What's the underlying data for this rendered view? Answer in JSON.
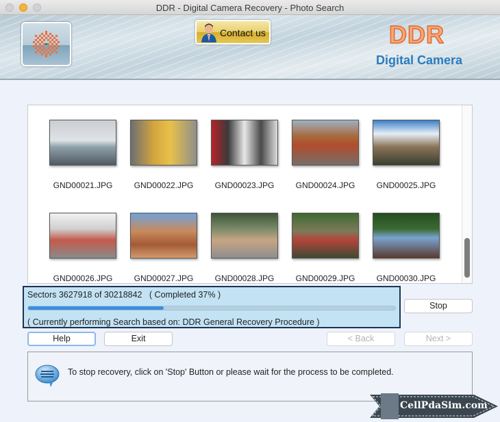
{
  "window": {
    "title": "DDR - Digital Camera Recovery - Photo Search"
  },
  "header": {
    "contact_label": "Contact us",
    "brand_title": "DDR",
    "brand_subtitle": "Digital Camera"
  },
  "gallery": {
    "items": [
      {
        "name": "GND00021.JPG"
      },
      {
        "name": "GND00022.JPG"
      },
      {
        "name": "GND00023.JPG"
      },
      {
        "name": "GND00024.JPG"
      },
      {
        "name": "GND00025.JPG"
      },
      {
        "name": "GND00026.JPG"
      },
      {
        "name": "GND00027.JPG"
      },
      {
        "name": "GND00028.JPG"
      },
      {
        "name": "GND00029.JPG"
      },
      {
        "name": "GND00030.JPG"
      }
    ]
  },
  "progress": {
    "sectors_text": "Sectors 3627918 of 30218842   ( Completed 37% )",
    "sectors_done": 3627918,
    "sectors_total": 30218842,
    "percent": 37,
    "procedure_text": "( Currently performing Search based on: DDR General Recovery Procedure )",
    "accent_color": "#3a8ee0"
  },
  "buttons": {
    "stop": "Stop",
    "help": "Help",
    "exit": "Exit",
    "back": "< Back",
    "next": "Next >"
  },
  "info": {
    "message": "To stop recovery, click on 'Stop' Button or please wait for the process to be completed."
  },
  "watermark": {
    "text": "CellPdaSim.com"
  }
}
